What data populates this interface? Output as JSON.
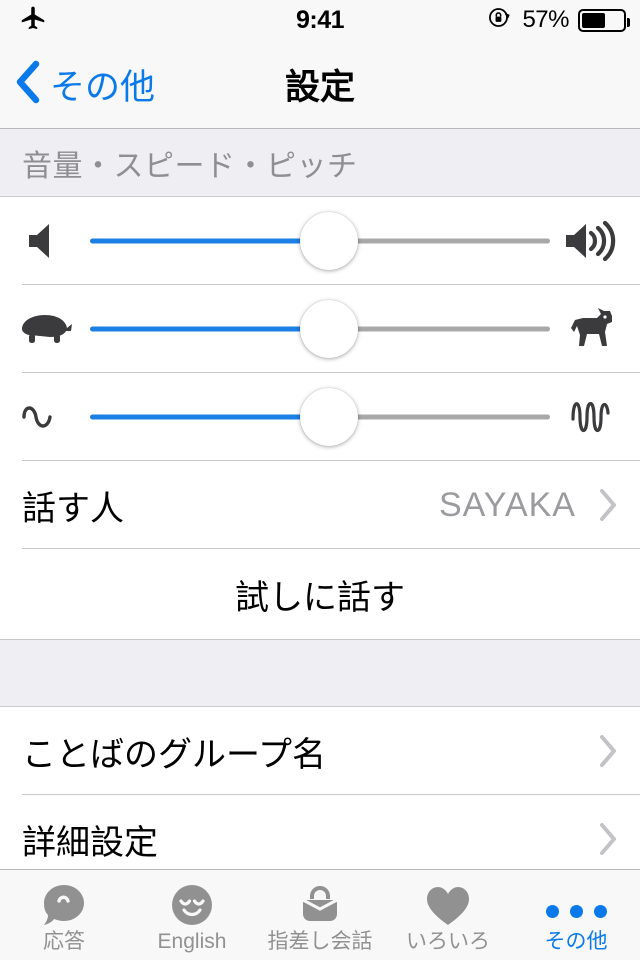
{
  "status_bar": {
    "airplane_icon": "airplane-mode-icon",
    "time": "9:41",
    "rotation_lock_icon": "rotation-lock-icon",
    "battery_percent_label": "57%",
    "battery_level": 57
  },
  "nav_bar": {
    "back_label": "その他",
    "back_icon": "chevron-left-icon",
    "title": "設定",
    "accent_color": "#0a7aeb"
  },
  "sections": {
    "voice": {
      "header": "音量・スピード・ピッチ",
      "sliders": [
        {
          "name": "volume",
          "left_icon": "speaker-mute-icon",
          "right_icon": "speaker-loud-icon",
          "value": 52
        },
        {
          "name": "speed",
          "left_icon": "turtle-icon",
          "right_icon": "dog-icon",
          "value": 52
        },
        {
          "name": "pitch",
          "left_icon": "low-wave-icon",
          "right_icon": "high-wave-icon",
          "value": 52
        }
      ],
      "speaker_row": {
        "title": "話す人",
        "value": "SAYAKA",
        "chevron_icon": "chevron-right-icon"
      },
      "test_speak_label": "試しに話す"
    },
    "other": {
      "rows": [
        {
          "title": "ことばのグループ名",
          "chevron_icon": "chevron-right-icon"
        },
        {
          "title": "詳細設定",
          "chevron_icon": "chevron-right-icon"
        }
      ]
    }
  },
  "tab_bar": {
    "tabs": [
      {
        "label": "応答",
        "icon": "speech-bubble-icon",
        "active": false
      },
      {
        "label": "English",
        "icon": "smiley-face-icon",
        "active": false
      },
      {
        "label": "指差し会話",
        "icon": "basket-icon",
        "active": false
      },
      {
        "label": "いろいろ",
        "icon": "heart-icon",
        "active": false
      },
      {
        "label": "その他",
        "icon": "more-dots-icon",
        "active": true
      }
    ]
  }
}
